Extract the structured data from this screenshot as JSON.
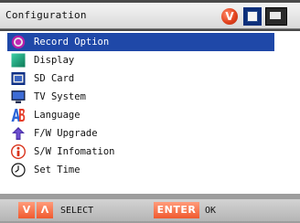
{
  "header": {
    "title": "Configuration",
    "badge": "V",
    "mode_icons": [
      "camera-mode-icon",
      "playback-mode-icon"
    ]
  },
  "menu": {
    "items": [
      {
        "label": "Record Option",
        "icon": "record-option-icon",
        "selected": true
      },
      {
        "label": "Display",
        "icon": "display-icon",
        "selected": false
      },
      {
        "label": "SD Card",
        "icon": "sd-card-icon",
        "selected": false
      },
      {
        "label": "TV System",
        "icon": "tv-system-icon",
        "selected": false
      },
      {
        "label": "Language",
        "icon": "language-icon",
        "selected": false
      },
      {
        "label": "F/W Upgrade",
        "icon": "firmware-upgrade-icon",
        "selected": false
      },
      {
        "label": "S/W Infomation",
        "icon": "info-icon",
        "selected": false
      },
      {
        "label": "Set Time",
        "icon": "clock-icon",
        "selected": false
      }
    ]
  },
  "footer": {
    "down_key": "V",
    "up_key": "Λ",
    "select_label": "SELECT",
    "enter_key": "ENTER",
    "ok_label": "OK"
  },
  "colors": {
    "selection": "#1f48a8",
    "accent": "#f05a2f",
    "background": "#9d9d9d"
  }
}
